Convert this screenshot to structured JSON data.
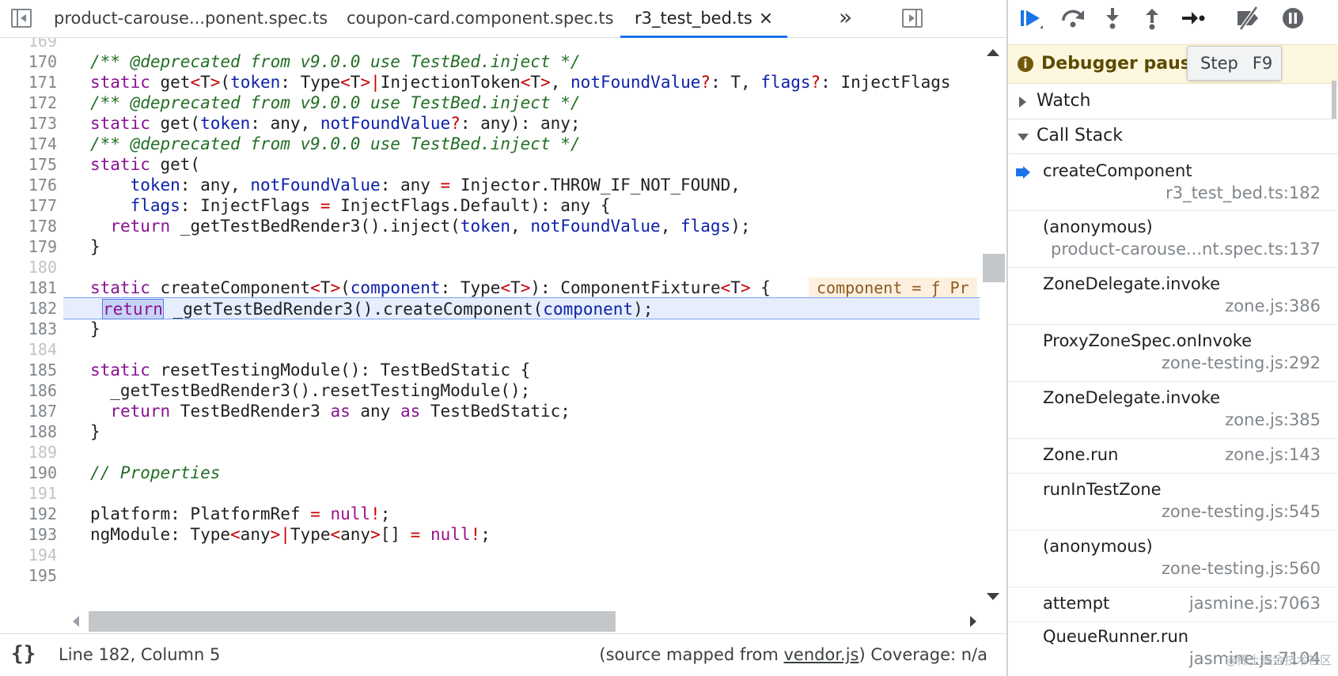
{
  "tabs": [
    {
      "label": "product-carouse...ponent.spec.ts",
      "active": false
    },
    {
      "label": "coupon-card.component.spec.ts",
      "active": false
    },
    {
      "label": "r3_test_bed.ts",
      "active": true,
      "close": "×"
    }
  ],
  "tab_more": "»",
  "editor": {
    "inline_value": "component = ƒ Pr"
  },
  "status": {
    "braces": "{}",
    "position": "Line 182, Column 5",
    "source_prefix": "(source mapped from ",
    "source_link": "vendor.js",
    "source_suffix": ")",
    "coverage": "Coverage: n/a"
  },
  "debugger": {
    "paused_text": "Debugger paused",
    "tooltip_label": "Step",
    "tooltip_key": "F9",
    "watch_label": "Watch",
    "callstack_label": "Call Stack",
    "frames": [
      {
        "fn": "createComponent",
        "loc": "r3_test_bed.ts:182",
        "current": true
      },
      {
        "fn": "(anonymous)",
        "loc": "product-carouse...nt.spec.ts:137"
      },
      {
        "fn": "ZoneDelegate.invoke",
        "loc": "zone.js:386"
      },
      {
        "fn": "ProxyZoneSpec.onInvoke",
        "loc": "zone-testing.js:292"
      },
      {
        "fn": "ZoneDelegate.invoke",
        "loc": "zone.js:385"
      },
      {
        "fn": "Zone.run",
        "loc": "zone.js:143"
      },
      {
        "fn": "runInTestZone",
        "loc": "zone-testing.js:545"
      },
      {
        "fn": "(anonymous)",
        "loc": "zone-testing.js:560"
      },
      {
        "fn": "attempt",
        "loc": "jasmine.js:7063"
      },
      {
        "fn": "QueueRunner.run",
        "loc": "jasmine.js:7104"
      }
    ],
    "watermark": "@稀土掘金技术社区"
  },
  "colors": {
    "accent": "#1a73e8",
    "highlight_line": "#e6edfd",
    "paused_banner": "#fef7e0"
  }
}
